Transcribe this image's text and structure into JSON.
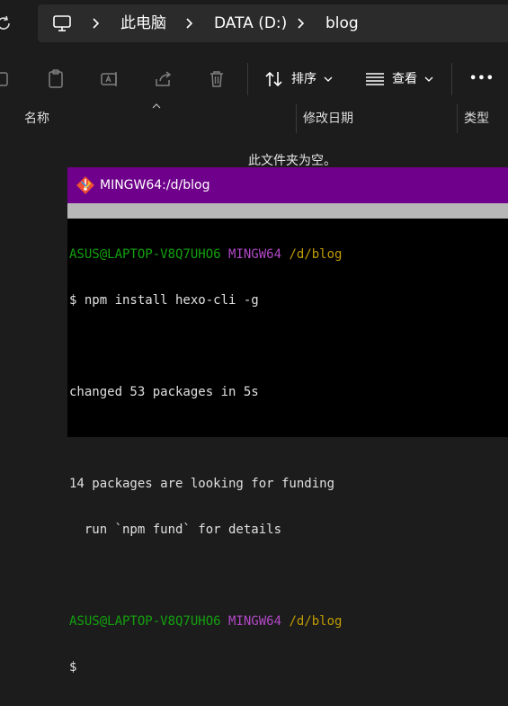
{
  "address_bar": {
    "crumbs": [
      "此电脑",
      "DATA (D:)",
      "blog"
    ]
  },
  "toolbar": {
    "sort_label": "排序",
    "view_label": "查看",
    "more_label": "•••"
  },
  "columns": [
    "名称",
    "修改日期",
    "类型"
  ],
  "empty_message": "此文件夹为空。",
  "terminal": {
    "title": "MINGW64:/d/blog",
    "prompt_user": "ASUS@LAPTOP-V8Q7UHO6",
    "prompt_env": "MINGW64",
    "prompt_path": "/d/blog",
    "lines": {
      "cmd1": "$ npm install hexo-cli -g",
      "out1": "changed 53 packages in 5s",
      "out2": "14 packages are looking for funding",
      "out3": "  run `npm fund` for details",
      "cmd2": "$"
    }
  },
  "colors": {
    "terminal_title_bg": "#6f008b",
    "prompt_user": "#13a10e",
    "prompt_env": "#b148c6",
    "prompt_path": "#c19c00"
  }
}
